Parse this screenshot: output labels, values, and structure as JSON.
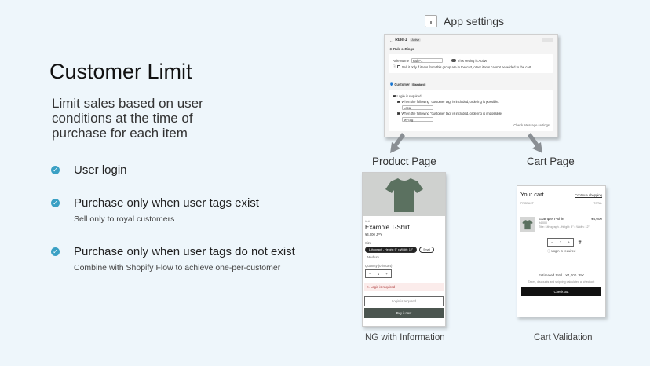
{
  "title": "Customer Limit",
  "subtitle": "Limit sales based on user conditions at the time of purchase for each item",
  "features": [
    {
      "label": "User login",
      "sub": ""
    },
    {
      "label": "Purchase only when user tags exist",
      "sub": "Sell only to royal customers"
    },
    {
      "label": "Purchase only when user tags do not exist",
      "sub": "Combine with Shopify Flow to achieve one-per-customer"
    }
  ],
  "app_settings": {
    "label": "App settings",
    "rule_title": "Rule-1",
    "rule_badge": "Active",
    "rule_settings_header": "Rule settings",
    "rule_name_label": "Rule Name",
    "rule_name_value": "Rule-1",
    "active_text": "This setting is Active",
    "sell_text": "Sell it only if items from this group are in the cart, other items cannot be added to the cart.",
    "customer_header": "Customer",
    "customer_badge": "Standard",
    "login_required": "Login is required",
    "tag_possible_text": "When the following \"customer tag\" is included, ordering is possible.",
    "tag_possible_value": "Local",
    "tag_impossible_text": "When the following \"customer tag\" is included, ordering is impossible.",
    "tag_impossible_value": "MyTag",
    "check_message": "Check Message settings"
  },
  "product_page": {
    "caption": "Product Page",
    "bottom_caption": "NG with Information",
    "vendor": "Unit",
    "title": "Example T-Shirt",
    "price": "¥4,000 JPY",
    "option_label": "Size",
    "option_selected": "Lithograph - Height: 9\" x Width: 12\"",
    "option_other": "Small",
    "option_other2": "Medium",
    "qty_label": "Quantity (0 in cart)",
    "qty": "1",
    "error_text": "Login is required",
    "login_button": "Login is required",
    "buy_button": "Buy it now"
  },
  "cart_page": {
    "caption": "Cart Page",
    "bottom_caption": "Cart Validation",
    "title": "Your cart",
    "continue": "Continue shopping",
    "col_product": "PRODUCT",
    "col_total": "TOTAL",
    "item_name": "Example T-Shirt",
    "item_unit_price": "¥4,000",
    "item_variant": "Title: Lithograph - Height: 9\" x Width: 12\"",
    "item_total": "¥4,000",
    "qty": "1",
    "login_note": "Login is required",
    "estimated_label": "Estimated total",
    "estimated_value": "¥4,000 JPY",
    "tax_note": "Taxes, discounts and shipping calculated at checkout",
    "checkout": "Check out"
  },
  "colors": {
    "accent": "#3aa0c4",
    "background": "#eef6fb",
    "arrow": "#8a8f94"
  }
}
